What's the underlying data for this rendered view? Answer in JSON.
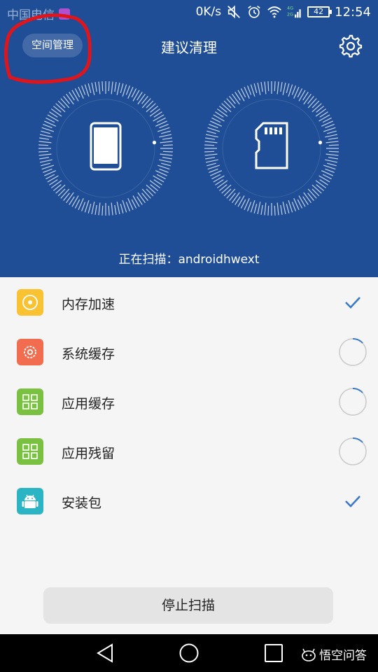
{
  "status_bar": {
    "carrier": "中国电信",
    "net_speed": "0K/s",
    "battery": "42",
    "time": "12:54",
    "net_4g": "4G",
    "net_2g": "2G"
  },
  "header": {
    "space_button": "空间管理",
    "title": "建议清理"
  },
  "scan": {
    "text": "正在扫描：androidhwext"
  },
  "items": [
    {
      "label": "内存加速",
      "icon": "target-icon",
      "color": "#f8c233",
      "state": "done"
    },
    {
      "label": "系统缓存",
      "icon": "gear-icon",
      "color": "#f26c4f",
      "state": "scanning"
    },
    {
      "label": "应用缓存",
      "icon": "grid-icon",
      "color": "#7ac142",
      "state": "scanning"
    },
    {
      "label": "应用残留",
      "icon": "grid-icon",
      "color": "#7ac142",
      "state": "scanning"
    },
    {
      "label": "安装包",
      "icon": "android-icon",
      "color": "#2bb5c4",
      "state": "done"
    }
  ],
  "stop_button": "停止扫描",
  "watermark": "悟空问答",
  "colors": {
    "header_bg": "#1f4e96",
    "check": "#3a7ac9",
    "annotation": "#e0141b"
  }
}
